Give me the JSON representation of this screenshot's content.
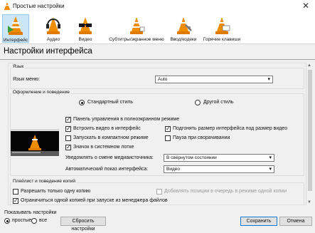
{
  "window": {
    "title": "Простые настройки",
    "close_glyph": "✕"
  },
  "toolbar": {
    "items": [
      {
        "label": "Интерфейс",
        "icon": "interface-cone-icon"
      },
      {
        "label": "Аудио",
        "icon": "headphones-cone-icon"
      },
      {
        "label": "Видео",
        "icon": "glasses-cone-icon"
      },
      {
        "label": "Субтитры/экранное меню",
        "icon": "subtitles-cone-icon"
      },
      {
        "label": "Ввод/кодеки",
        "icon": "codec-cone-icon"
      },
      {
        "label": "Горячие клавиши",
        "icon": "hotkeys-cone-icon"
      }
    ]
  },
  "page_title": "Настройки интерфейса",
  "language": {
    "legend": "Язык",
    "menu_language_label": "Язык меню:",
    "menu_language_value": "Auto"
  },
  "look": {
    "legend": "Оформление и поведение",
    "style_standard": "Стандартный стиль",
    "style_other": "Другой стиль",
    "opt_fullscreen_controls": "Панель управления в полноэкранном режиме",
    "opt_embed_video": "Встроить видео в интерфейс",
    "opt_resize_to_video": "Подгонять размер интерфейса под размер видео",
    "opt_minimal_view": "Запускать в компактном режиме",
    "opt_pause_minimized": "Пауза при сворачивании",
    "opt_systray": "Значок в системном лотке",
    "notify_label": "Уведомлять о смене медиаисточника:",
    "notify_value": "В свёрнутом состоянии",
    "autoraise_label": "Автоматический показ интерфейса:",
    "autoraise_value": "Видео"
  },
  "playlist": {
    "legend": "Плейлист и поведение копий",
    "opt_one_instance": "Разрешить только одну копию",
    "opt_enqueue": "Добавлять позиции в очередь в режиме одной копии",
    "opt_one_instance_fm": "Ограничиться одной копией при запуске из менеджера файлов"
  },
  "bottom": {
    "show_settings_label": "Показывать настройки",
    "simple_label": "простые",
    "all_label": "все",
    "reset_button": "Сбросить настройки",
    "save_button": "Сохранить",
    "cancel_button": "Отмена"
  },
  "colors": {
    "accent": "#0078d7",
    "cone_orange": "#f08c00",
    "active_tab": "#cde6f7"
  }
}
